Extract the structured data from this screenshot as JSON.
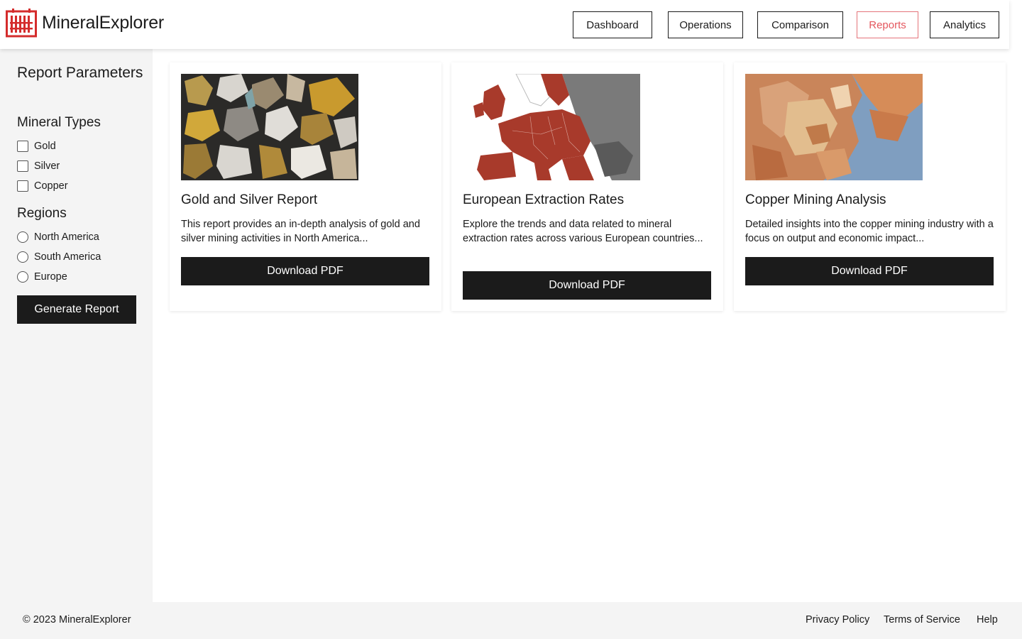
{
  "brand": {
    "name": "MineralExplorer",
    "logo_icon": "building-grid-icon",
    "logo_color": "#d42c2c"
  },
  "nav": [
    {
      "label": "Dashboard",
      "active": false
    },
    {
      "label": "Operations",
      "active": false
    },
    {
      "label": "Comparison",
      "active": false
    },
    {
      "label": "Reports",
      "active": true
    },
    {
      "label": "Analytics",
      "active": false
    }
  ],
  "sidebar": {
    "title": "Report Parameters",
    "mineral_types": {
      "heading": "Mineral Types",
      "options": [
        "Gold",
        "Silver",
        "Copper"
      ]
    },
    "regions": {
      "heading": "Regions",
      "options": [
        "North America",
        "South America",
        "Europe"
      ]
    },
    "generate_label": "Generate Report"
  },
  "cards": [
    {
      "title": "Gold and Silver Report",
      "description": "This report provides an in-depth analysis of gold and silver mining activities in North America...",
      "button": "Download PDF"
    },
    {
      "title": "European Extraction Rates",
      "description": "Explore the trends and data related to mineral extraction rates across various European countries...",
      "button": "Download PDF"
    },
    {
      "title": "Copper Mining Analysis",
      "description": "Detailed insights into the copper mining industry with a focus on output and economic impact...",
      "button": "Download PDF"
    }
  ],
  "footer": {
    "copyright": "© 2023 MineralExplorer",
    "links": [
      "Privacy Policy",
      "Terms of Service",
      "Help"
    ]
  },
  "colors": {
    "accent": "#e4575e",
    "dark": "#1b1b1b",
    "panel": "#f4f4f4"
  }
}
